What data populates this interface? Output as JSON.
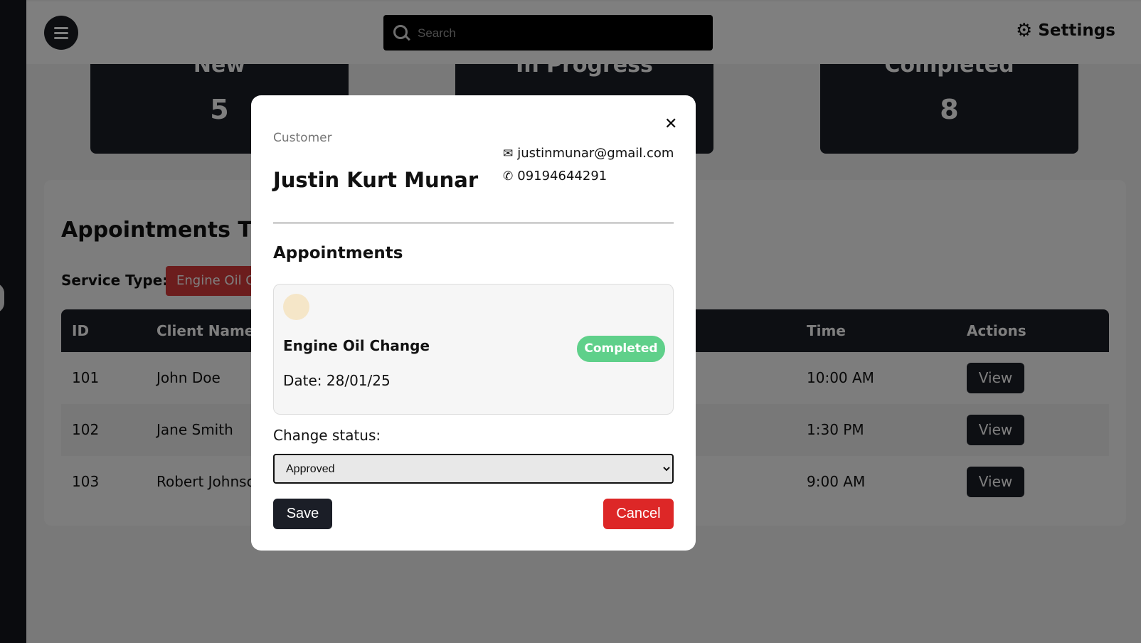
{
  "header": {
    "search_placeholder": "Search",
    "settings_label": "Settings",
    "settings_icon": "gear-icon",
    "menu_icon": "hamburger-icon"
  },
  "stats": [
    {
      "label": "New",
      "value": "5"
    },
    {
      "label": "In Progress",
      "value": ""
    },
    {
      "label": "Completed",
      "value": "8"
    }
  ],
  "panel": {
    "title": "Appointments Tracker",
    "service_type_label": "Service Type:",
    "service_type_value": "Engine Oil Change"
  },
  "table": {
    "columns": [
      "ID",
      "Client Name",
      "Time",
      "Actions"
    ],
    "rows": [
      {
        "id": "101",
        "client": "John Doe",
        "time": "10:00 AM",
        "action": "View"
      },
      {
        "id": "102",
        "client": "Jane Smith",
        "time": "1:30 PM",
        "action": "View"
      },
      {
        "id": "103",
        "client": "Robert Johnson",
        "time": "9:00 AM",
        "action": "View"
      }
    ]
  },
  "modal": {
    "customer_label": "Customer",
    "customer_name": "Justin Kurt Munar",
    "email": "justinmunar@gmail.com",
    "phone": "09194644291",
    "appointments_title": "Appointments",
    "appointment": {
      "service": "Engine Oil Change",
      "date": "Date: 28/01/25",
      "status": "Completed"
    },
    "change_status_label": "Change status:",
    "status_selected": "Approved",
    "save_label": "Save",
    "cancel_label": "Cancel",
    "close_icon": "close-icon"
  },
  "colors": {
    "dark": "#1b1e27",
    "danger": "#dd2727",
    "success": "#5fd08a",
    "service_type_bg": "#d93a3a"
  }
}
